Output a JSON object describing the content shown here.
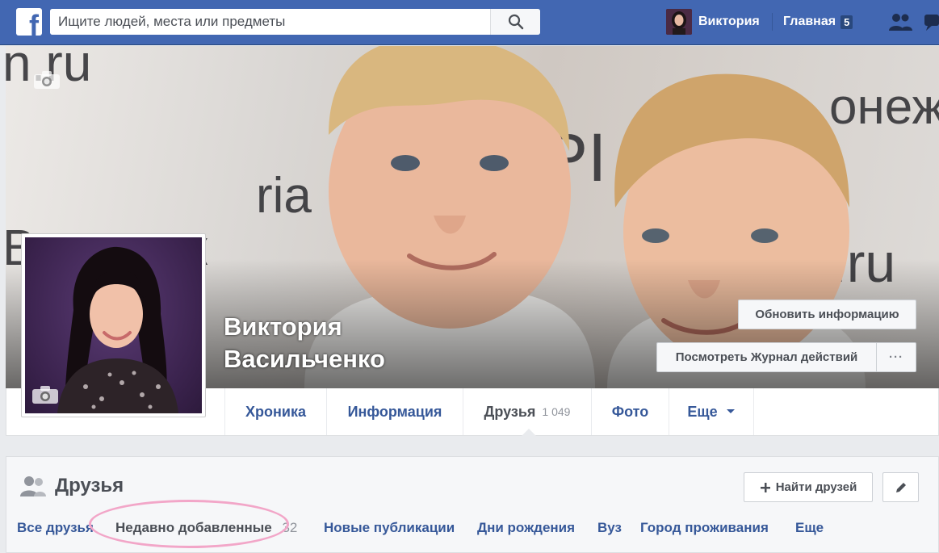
{
  "topbar": {
    "search_placeholder": "Ищите людей, места или предметы",
    "user_name": "Виктория",
    "home_label": "Главная",
    "home_badge": "5",
    "brand_color": "#4267b2"
  },
  "profile": {
    "name_line1": "Виктория",
    "name_line2": "Васильченко",
    "update_info_label": "Обновить информацию",
    "activity_log_label": "Посмотреть Журнал действий",
    "more_label": "···"
  },
  "cover_text": {
    "t1": "n.ru",
    "t2": "ria",
    "t3": "Воронеж",
    "t4": "n.ru",
    "t5": "онеж",
    "t6": "PI"
  },
  "nav": {
    "tabs": [
      {
        "label": "Хроника"
      },
      {
        "label": "Информация"
      },
      {
        "label": "Друзья",
        "count": "1 049"
      },
      {
        "label": "Фото"
      },
      {
        "label": "Еще"
      }
    ]
  },
  "friends": {
    "title": "Друзья",
    "find_label": "Найти друзей",
    "subtabs": [
      {
        "label": "Все друзья"
      },
      {
        "label": "Недавно добавленные",
        "count": "32"
      },
      {
        "label": "Новые публикации"
      },
      {
        "label": "Дни рождения"
      },
      {
        "label": "Вуз"
      },
      {
        "label": "Город проживания"
      },
      {
        "label": "Еще"
      }
    ]
  }
}
